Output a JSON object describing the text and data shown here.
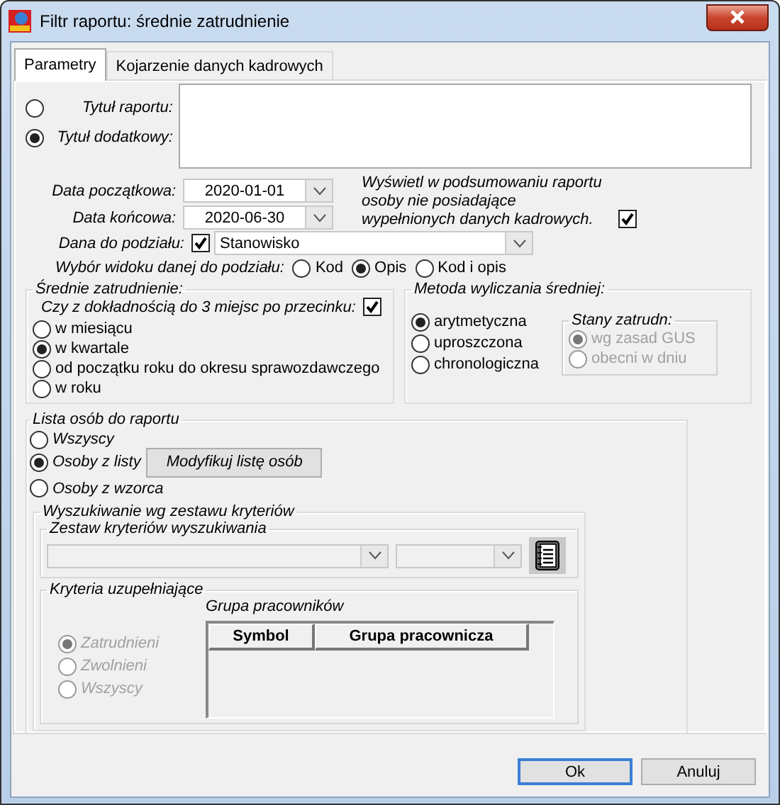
{
  "window": {
    "title": "Filtr raportu: średnie zatrudnienie"
  },
  "tabs": [
    {
      "label": "Parametry",
      "selected": true
    },
    {
      "label": "Kojarzenie danych kadrowych",
      "selected": false
    }
  ],
  "title_options": [
    {
      "label": "Tytuł raportu:",
      "selected": false
    },
    {
      "label": "Tytuł dodatkowy:",
      "selected": true
    }
  ],
  "dates": [
    {
      "label": "Data początkowa:",
      "value": "2020-01-01"
    },
    {
      "label": "Data końcowa:",
      "value": "2020-06-30"
    }
  ],
  "summary_note": {
    "text": "Wyświetl w podsumowaniu raportu osoby nie posiadające wypełnionych danych kadrowych.",
    "checked": true
  },
  "split": {
    "label": "Dana do podziału:",
    "checked": true,
    "value": "Stanowisko"
  },
  "view_choice": {
    "label": "Wybór widoku danej do podziału:",
    "options": [
      {
        "label": "Kod",
        "selected": false
      },
      {
        "label": "Opis",
        "selected": true
      },
      {
        "label": "Kod i opis",
        "selected": false
      }
    ]
  },
  "average": {
    "title": "Średnie zatrudnienie:",
    "precision_label": "Czy z dokładnością do 3 miejsc po przecinku:",
    "precision_checked": true,
    "options": [
      {
        "label": "w miesiącu",
        "selected": false
      },
      {
        "label": "w kwartale",
        "selected": true
      },
      {
        "label": "od początku roku do okresu sprawozdawczego",
        "selected": false
      },
      {
        "label": "w roku",
        "selected": false
      }
    ]
  },
  "method": {
    "title": "Metoda wyliczania średniej:",
    "options": [
      {
        "label": "arytmetyczna",
        "selected": true
      },
      {
        "label": "uproszczona",
        "selected": false
      },
      {
        "label": "chronologiczna",
        "selected": false
      }
    ],
    "states": {
      "title": "Stany zatrudn:",
      "disabled": true,
      "options": [
        {
          "label": "wg zasad GUS",
          "selected": true
        },
        {
          "label": "obecni w dniu",
          "selected": false
        }
      ]
    }
  },
  "people_list": {
    "title": "Lista osób do raportu",
    "options": [
      {
        "label": "Wszyscy",
        "selected": false
      },
      {
        "label": "Osoby z listy",
        "selected": true
      },
      {
        "label": "Osoby z wzorca",
        "selected": false
      }
    ],
    "modify_button": "Modyfikuj listę osób"
  },
  "search": {
    "title": "Wyszukiwanie wg zestawu kryteriów",
    "criteria_set": {
      "title": "Zestaw kryteriów wyszukiwania",
      "disabled": true
    },
    "supplementary": {
      "title": "Kryteria uzupełniające",
      "disabled": true,
      "options": [
        {
          "label": "Zatrudnieni",
          "selected": true
        },
        {
          "label": "Zwolnieni",
          "selected": false
        },
        {
          "label": "Wszyscy",
          "selected": false
        }
      ]
    },
    "group": {
      "title": "Grupa pracowników",
      "columns": [
        "Symbol",
        "Grupa pracownicza"
      ]
    }
  },
  "buttons": [
    {
      "label": "Ok",
      "default": true
    },
    {
      "label": "Anuluj",
      "default": false
    }
  ]
}
